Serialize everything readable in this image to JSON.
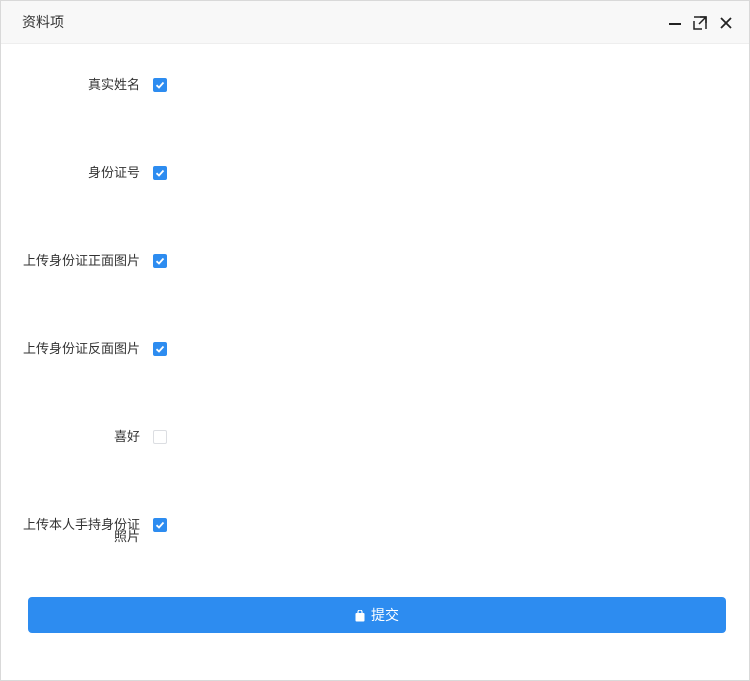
{
  "dialog": {
    "title": "资料项",
    "controls": {
      "minimize_icon": "minimize-icon",
      "maximize_icon": "maximize-icon",
      "close_icon": "close-icon"
    }
  },
  "form": {
    "fields": [
      {
        "label": "真实姓名",
        "checked": true
      },
      {
        "label": "身份证号",
        "checked": true
      },
      {
        "label": "上传身份证正面图片",
        "checked": true
      },
      {
        "label": "上传身份证反面图片",
        "checked": true
      },
      {
        "label": "喜好",
        "checked": false
      },
      {
        "label_line1": "上传本人手持身份证",
        "label_line2": "照片",
        "checked": true
      }
    ]
  },
  "submit": {
    "label": "提交",
    "icon": "bag-icon"
  },
  "colors": {
    "accent": "#2d8cf0",
    "titlebar_bg": "#f8f8f8",
    "text": "#333333"
  }
}
